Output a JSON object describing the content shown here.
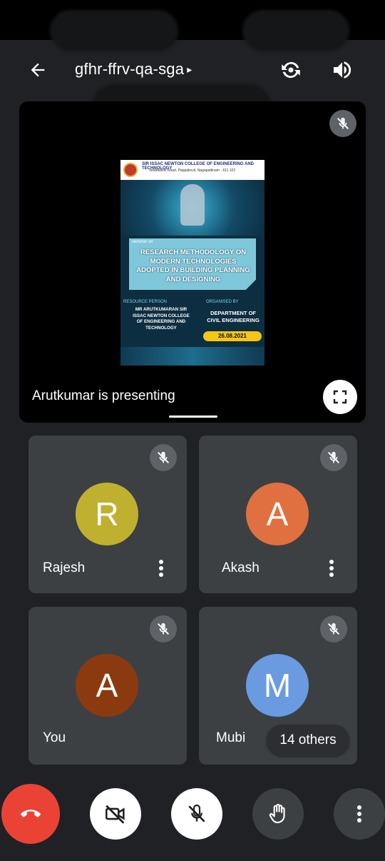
{
  "header": {
    "meeting_code": "gfhr-ffrv-qa-sga",
    "caret": "▸"
  },
  "presentation": {
    "presenting_label": "Arutkumar is presenting",
    "slide": {
      "college_name": "SIR ISSAC NEWTON COLLEGE OF ENGINEERING AND TECHNOLOGY",
      "college_address": "Velankanni Road, Pappakovil, Nagapattinam - 611 102",
      "seminar_on": "seminar on",
      "title": "RESEARCH METHODOLOGY ON MODERN TECHNOLOGIES ADOPTED IN BUILDING PLANNING AND DESIGNING",
      "resource_person_label": "RESOURCE PERSON",
      "resource_person": "MR ARUTKUMARAN SIR ISSAC NEWTON COLLEGE OF ENGINEERING AND TECHNOLOGY",
      "organised_by_label": "ORGANISED BY",
      "organised_by": "DEPARTMENT OF CIVIL ENGINEERING",
      "date": "26.08.2021"
    }
  },
  "participants": [
    {
      "name": "Rajesh",
      "initial": "R",
      "color": "#c0b030"
    },
    {
      "name": "Akash",
      "initial": "A",
      "color": "#e07040"
    },
    {
      "name": "You",
      "initial": "A",
      "color": "#8b3a10"
    },
    {
      "name": "Mubi",
      "initial": "M",
      "color": "#6a9be0"
    }
  ],
  "others_count_label": "14 others",
  "colors": {
    "background": "#202124",
    "tile": "#3c4043",
    "end_call": "#ea4335",
    "control_light": "#ffffff",
    "control_dark": "#3c4043"
  },
  "icons": {
    "back": "arrow-back-icon",
    "switch_camera": "switch-camera-icon",
    "speaker": "volume-icon",
    "mic_off": "mic-off-icon",
    "fullscreen": "fullscreen-icon",
    "more": "more-vert-icon",
    "end_call": "call-end-icon",
    "camera_off": "videocam-off-icon",
    "raise_hand": "hand-icon"
  }
}
